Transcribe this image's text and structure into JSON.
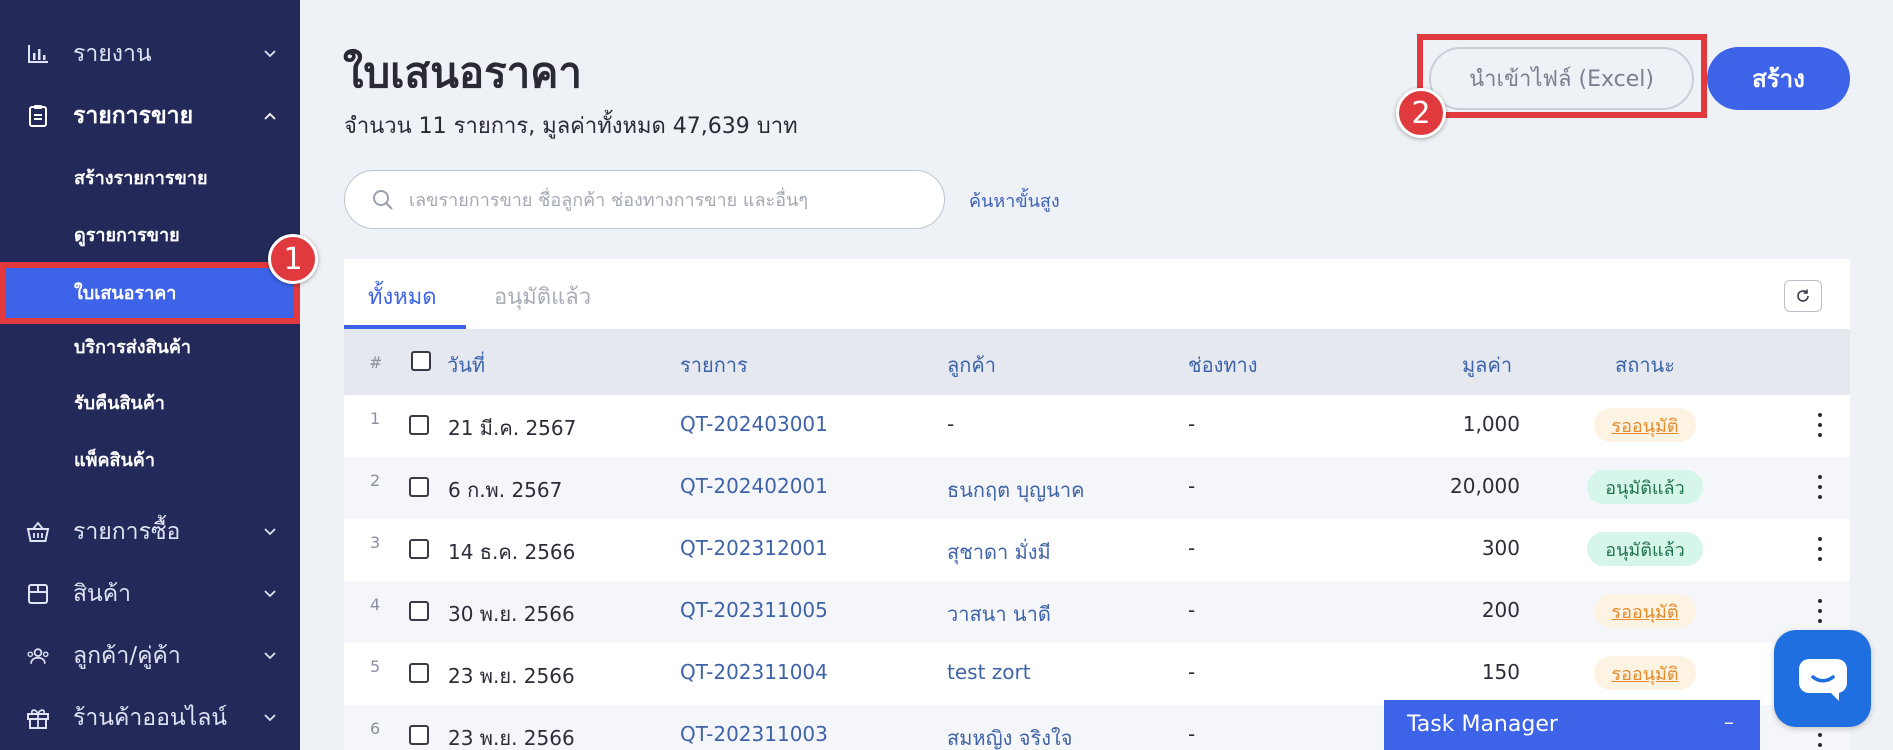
{
  "sidebar": {
    "items": [
      {
        "label": "รายงาน",
        "icon": "bar-chart-icon"
      },
      {
        "label": "รายการขาย",
        "icon": "clipboard-icon"
      },
      {
        "label": "รายการซื้อ",
        "icon": "basket-icon"
      },
      {
        "label": "สินค้า",
        "icon": "box-icon"
      },
      {
        "label": "ลูกค้า/คู่ค้า",
        "icon": "people-icon"
      },
      {
        "label": "ร้านค้าออนไลน์",
        "icon": "gift-icon"
      }
    ],
    "sub_items": [
      {
        "label": "สร้างรายการขาย"
      },
      {
        "label": "ดูรายการขาย"
      },
      {
        "label": "ใบเสนอราคา"
      },
      {
        "label": "บริการส่งสินค้า"
      },
      {
        "label": "รับคืนสินค้า"
      },
      {
        "label": "แพ็คสินค้า"
      }
    ]
  },
  "markers": {
    "one": "1",
    "two": "2"
  },
  "header": {
    "title": "ใบเสนอราคา",
    "summary": "จำนวน 11 รายการ, มูลค่าทั้งหมด 47,639 บาท",
    "import_label": "นำเข้าไฟล์ (Excel)",
    "create_label": "สร้าง"
  },
  "search": {
    "placeholder": "เลขรายการขาย ชื่อลูกค้า ช่องทางการขาย และอื่นๆ",
    "advanced_label": "ค้นหาขั้นสูง"
  },
  "tabs": [
    {
      "label": "ทั้งหมด"
    },
    {
      "label": "อนุมัติแล้ว"
    }
  ],
  "table": {
    "columns": {
      "num": "#",
      "date": "วันที่",
      "doc": "รายการ",
      "customer": "ลูกค้า",
      "channel": "ช่องทาง",
      "amount": "มูลค่า",
      "status": "สถานะ"
    },
    "rows": [
      {
        "idx": "1",
        "date": "21 มี.ค. 2567",
        "doc": "QT-202403001",
        "customer": "-",
        "channel": "-",
        "amount": "1,000",
        "status": "รออนุมัติ"
      },
      {
        "idx": "2",
        "date": "6 ก.พ. 2567",
        "doc": "QT-202402001",
        "customer": "ธนกฤต บุญนาค",
        "channel": "-",
        "amount": "20,000",
        "status": "อนุมัติแล้ว"
      },
      {
        "idx": "3",
        "date": "14 ธ.ค. 2566",
        "doc": "QT-202312001",
        "customer": "สุชาดา มั่งมี",
        "channel": "-",
        "amount": "300",
        "status": "อนุมัติแล้ว"
      },
      {
        "idx": "4",
        "date": "30 พ.ย. 2566",
        "doc": "QT-202311005",
        "customer": "วาสนา นาดี",
        "channel": "-",
        "amount": "200",
        "status": "รออนุมัติ"
      },
      {
        "idx": "5",
        "date": "23 พ.ย. 2566",
        "doc": "QT-202311004",
        "customer": "test zort",
        "channel": "-",
        "amount": "150",
        "status": "รออนุมัติ"
      },
      {
        "idx": "6",
        "date": "23 พ.ย. 2566",
        "doc": "QT-202311003",
        "customer": "สมหญิง จริงใจ",
        "channel": "-",
        "amount": "",
        "status": ""
      }
    ]
  },
  "task_manager": {
    "label": "Task Manager",
    "minimize": "–"
  },
  "colors": {
    "sidebar": "#232a59",
    "accent": "#3d63e8",
    "highlight": "#e0393e",
    "pending": "#e28a2c",
    "approved": "#22734f"
  }
}
